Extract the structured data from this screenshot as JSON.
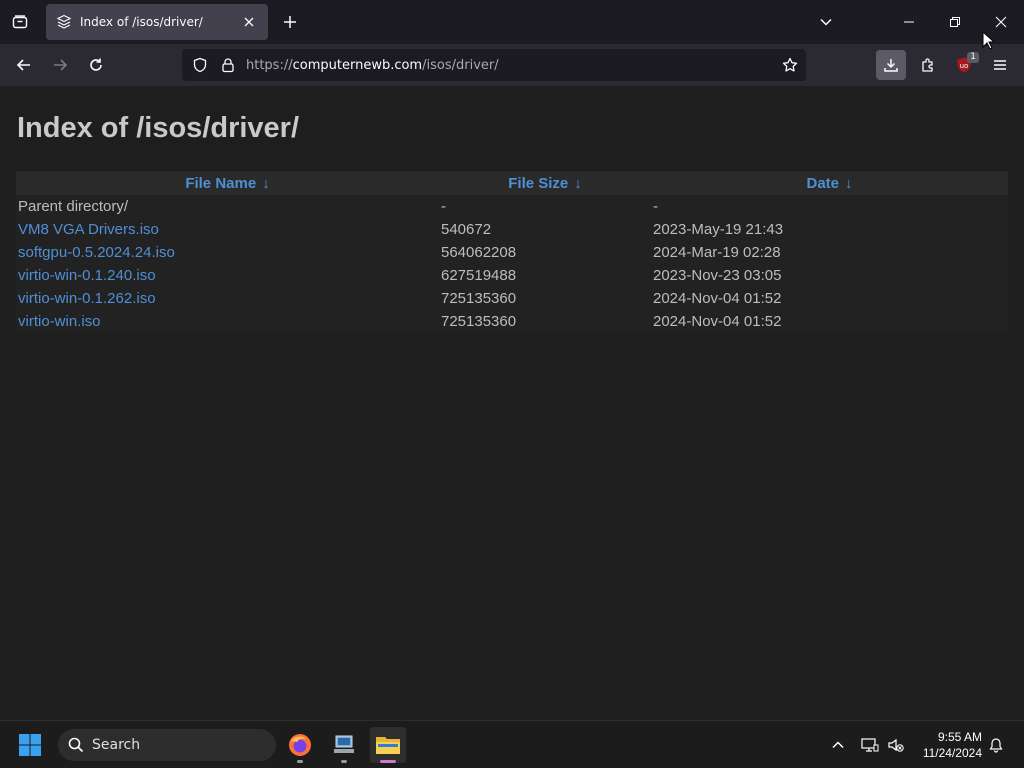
{
  "colors": {
    "link": "#4f8fd6",
    "page_bg": "#1e1e1e",
    "chrome_bg": "#1c1b22",
    "toolbar_bg": "#2b2a33"
  },
  "tab": {
    "title": "Index of /isos/driver/",
    "favicon": "folder-stack-icon"
  },
  "urlbar": {
    "protocol": "https://",
    "host": "computernewb.com",
    "path": "/isos/driver/"
  },
  "toolbar": {
    "extension_badge": "1"
  },
  "page": {
    "heading": "Index of /isos/driver/",
    "columns": {
      "name": "File Name",
      "size": "File Size",
      "date": "Date",
      "sort_glyph": "↓"
    },
    "rows": [
      {
        "name": "Parent directory/",
        "size": "-",
        "date": "-",
        "is_link": false
      },
      {
        "name": "VM8 VGA Drivers.iso",
        "size": "540672",
        "date": "2023-May-19 21:43",
        "is_link": true
      },
      {
        "name": "softgpu-0.5.2024.24.iso",
        "size": "564062208",
        "date": "2024-Mar-19 02:28",
        "is_link": true
      },
      {
        "name": "virtio-win-0.1.240.iso",
        "size": "627519488",
        "date": "2023-Nov-23 03:05",
        "is_link": true
      },
      {
        "name": "virtio-win-0.1.262.iso",
        "size": "725135360",
        "date": "2024-Nov-04 01:52",
        "is_link": true
      },
      {
        "name": "virtio-win.iso",
        "size": "725135360",
        "date": "2024-Nov-04 01:52",
        "is_link": true
      }
    ]
  },
  "taskbar": {
    "search_label": "Search",
    "time": "9:55 AM",
    "date": "11/24/2024"
  }
}
